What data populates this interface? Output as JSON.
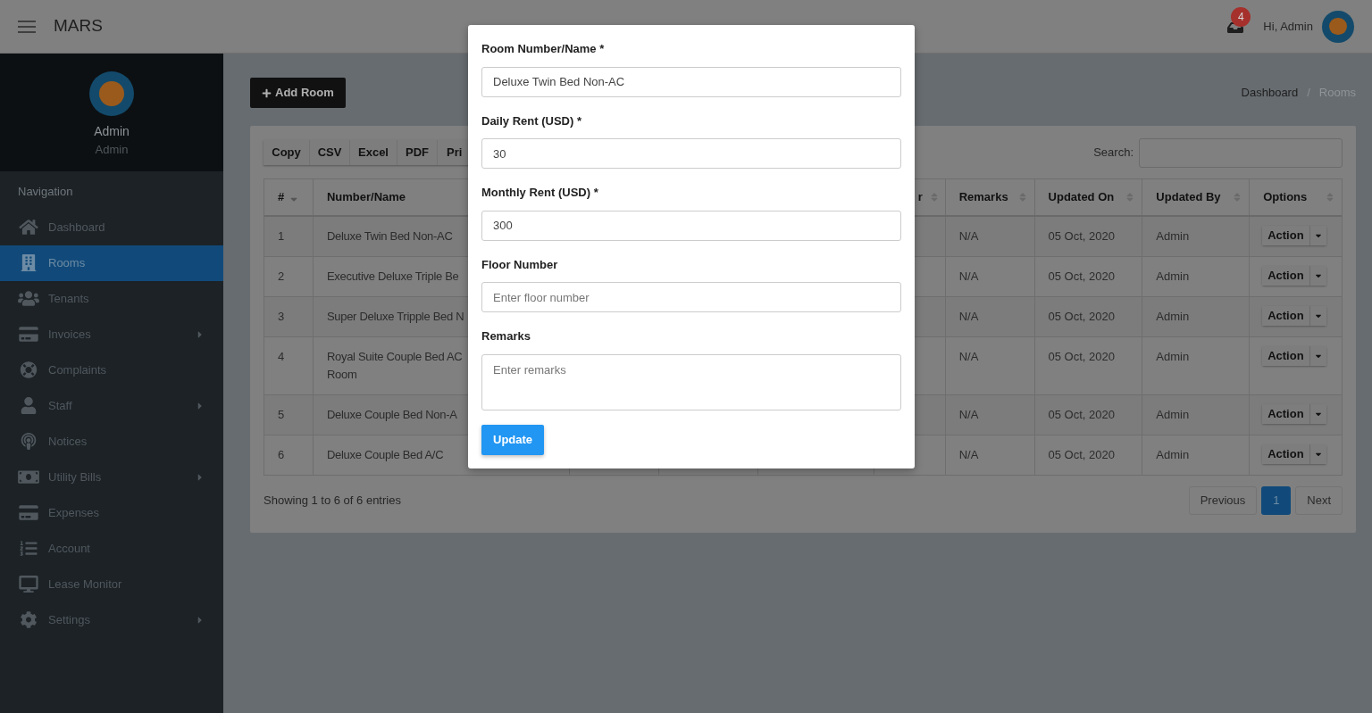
{
  "topbar": {
    "brand": "MARS",
    "notification_count": "4",
    "greeting": "Hi, Admin"
  },
  "sidebar": {
    "user": {
      "name": "Admin",
      "role": "Admin"
    },
    "section": "Navigation",
    "items": [
      {
        "label": "Dashboard",
        "selected": false,
        "expandable": false
      },
      {
        "label": "Rooms",
        "selected": true,
        "expandable": false
      },
      {
        "label": "Tenants",
        "selected": false,
        "expandable": false
      },
      {
        "label": "Invoices",
        "selected": false,
        "expandable": true
      },
      {
        "label": "Complaints",
        "selected": false,
        "expandable": false
      },
      {
        "label": "Staff",
        "selected": false,
        "expandable": true
      },
      {
        "label": "Notices",
        "selected": false,
        "expandable": false
      },
      {
        "label": "Utility Bills",
        "selected": false,
        "expandable": true
      },
      {
        "label": "Expenses",
        "selected": false,
        "expandable": false
      },
      {
        "label": "Account",
        "selected": false,
        "expandable": false
      },
      {
        "label": "Lease Monitor",
        "selected": false,
        "expandable": false
      },
      {
        "label": "Settings",
        "selected": false,
        "expandable": true
      }
    ]
  },
  "page": {
    "add_button": "Add Room",
    "breadcrumb_separator": "/",
    "breadcrumb": [
      {
        "label": "Dashboard",
        "selected": false
      },
      {
        "label": "Rooms",
        "selected": true
      }
    ]
  },
  "table": {
    "export_buttons": [
      "Copy",
      "CSV",
      "Excel",
      "PDF",
      "Pri"
    ],
    "search_label": "Search:",
    "columns_left": [
      {
        "label": "#",
        "sorted": true
      },
      {
        "label": "Number/Name"
      }
    ],
    "column_6": {
      "label": "r",
      "sorted": false
    },
    "columns_right": [
      {
        "label": "Remarks",
        "sorted": false
      },
      {
        "label": "Updated On",
        "sorted": false
      },
      {
        "label": "Updated By",
        "sorted": false
      },
      {
        "label": "Options",
        "sorted": false
      }
    ],
    "rows": [
      {
        "number": "1",
        "name": "Deluxe Twin Bed Non-AC",
        "remarks": "N/A",
        "updated_on": "05 Oct, 2020",
        "updated_by": "Admin",
        "action": "Action"
      },
      {
        "number": "2",
        "name": "Executive Deluxe Triple Be",
        "remarks": "N/A",
        "updated_on": "05 Oct, 2020",
        "updated_by": "Admin",
        "action": "Action"
      },
      {
        "number": "3",
        "name": "Super Deluxe Tripple Bed N",
        "remarks": "N/A",
        "updated_on": "05 Oct, 2020",
        "updated_by": "Admin",
        "action": "Action"
      },
      {
        "number": "4",
        "name": "Royal Suite Couple Bed AC Room",
        "remarks": "N/A",
        "updated_on": "05 Oct, 2020",
        "updated_by": "Admin",
        "action": "Action"
      },
      {
        "number": "5",
        "name": "Deluxe Couple Bed Non-A",
        "remarks": "N/A",
        "updated_on": "05 Oct, 2020",
        "updated_by": "Admin",
        "action": "Action"
      },
      {
        "number": "6",
        "name": "Deluxe Couple Bed A/C",
        "remarks": "N/A",
        "updated_on": "05 Oct, 2020",
        "updated_by": "Admin",
        "action": "Action"
      }
    ],
    "info": "Showing 1 to 6 of 6 entries",
    "pagination": {
      "previous": "Previous",
      "pages": [
        {
          "label": "1",
          "selected": true
        }
      ],
      "next": "Next"
    }
  },
  "modal": {
    "fields": [
      {
        "kind": "input",
        "label": "Room Number/Name *",
        "value": "Deluxe Twin Bed Non-AC"
      },
      {
        "kind": "input",
        "label": "Daily Rent (USD) *",
        "value": "30"
      },
      {
        "kind": "input",
        "label": "Monthly Rent (USD) *",
        "value": "300"
      },
      {
        "kind": "input",
        "label": "Floor Number",
        "placeholder": "Enter floor number"
      },
      {
        "kind": "textarea",
        "label": "Remarks",
        "placeholder": "Enter remarks"
      }
    ],
    "submit": "Update"
  }
}
